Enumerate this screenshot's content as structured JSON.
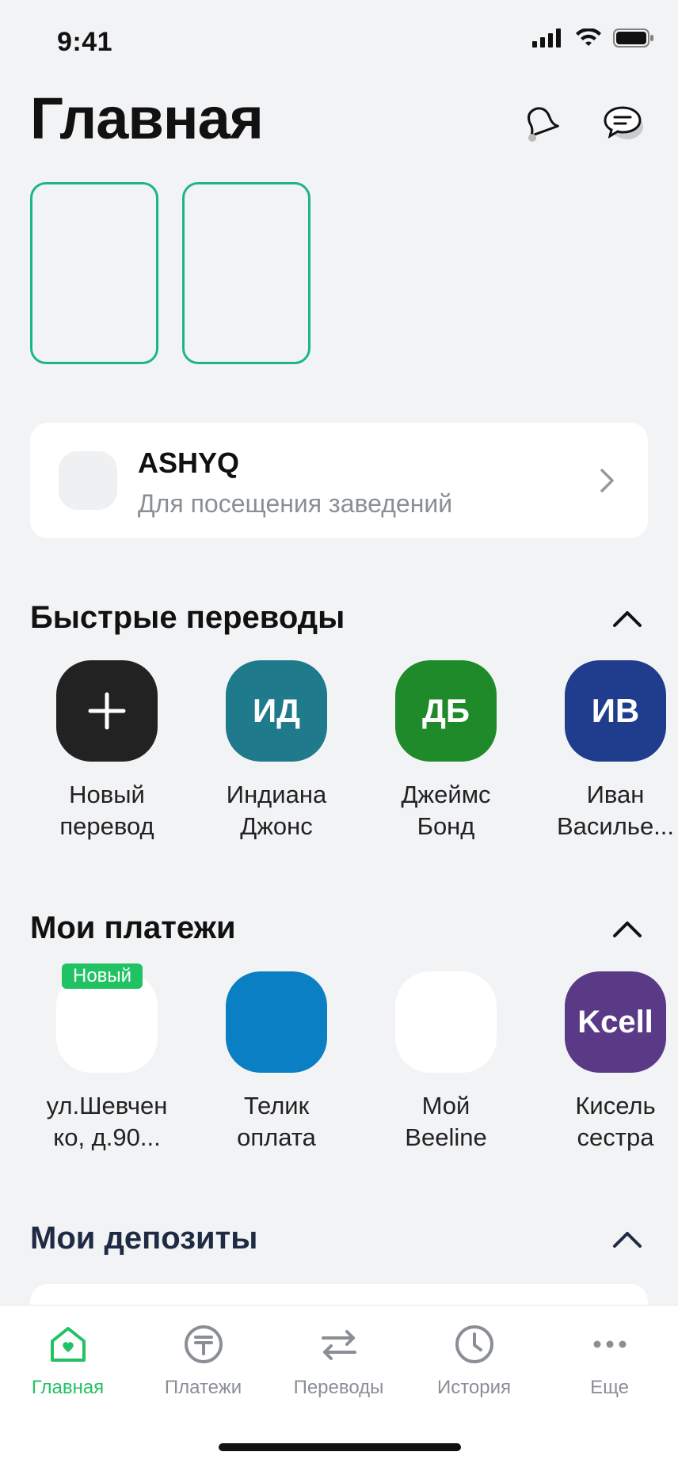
{
  "status_bar": {
    "time": "9:41"
  },
  "header": {
    "title": "Главная"
  },
  "ashyq": {
    "title": "ASHYQ",
    "subtitle": "Для посещения заведений"
  },
  "quick_transfers": {
    "title": "Быстрые переводы",
    "items": [
      {
        "initials": "+",
        "label": "Новый\nперевод",
        "color": "#222222"
      },
      {
        "initials": "ИД",
        "label": "Индиана\nДжонс",
        "color": "#1f7a8c"
      },
      {
        "initials": "ДБ",
        "label": "Джеймс\nБонд",
        "color": "#1f8a2a"
      },
      {
        "initials": "ИВ",
        "label": "Иван\nВасилье...",
        "color": "#1f3d8c"
      }
    ]
  },
  "payments": {
    "title": "Мои платежи",
    "badge": "Новый",
    "items": [
      {
        "initials": "",
        "label": "ул.Шевчен\nко, д.90...",
        "color": "#ffffff"
      },
      {
        "initials": "",
        "label": "Телик\nоплата",
        "color": "#0a7fc4"
      },
      {
        "initials": "",
        "label": "Мой\nBeeline",
        "color": "#ffffff"
      },
      {
        "initials": "Kcell",
        "label": "Кисель\nсестра",
        "color": "#5a3a86"
      }
    ]
  },
  "deposits": {
    "title": "Мои депозиты"
  },
  "tabbar": {
    "items": [
      {
        "label": "Главная"
      },
      {
        "label": "Платежи"
      },
      {
        "label": "Переводы"
      },
      {
        "label": "История"
      },
      {
        "label": "Еще"
      }
    ]
  },
  "colors": {
    "accent": "#21c263",
    "navy": "#1f2a44"
  }
}
